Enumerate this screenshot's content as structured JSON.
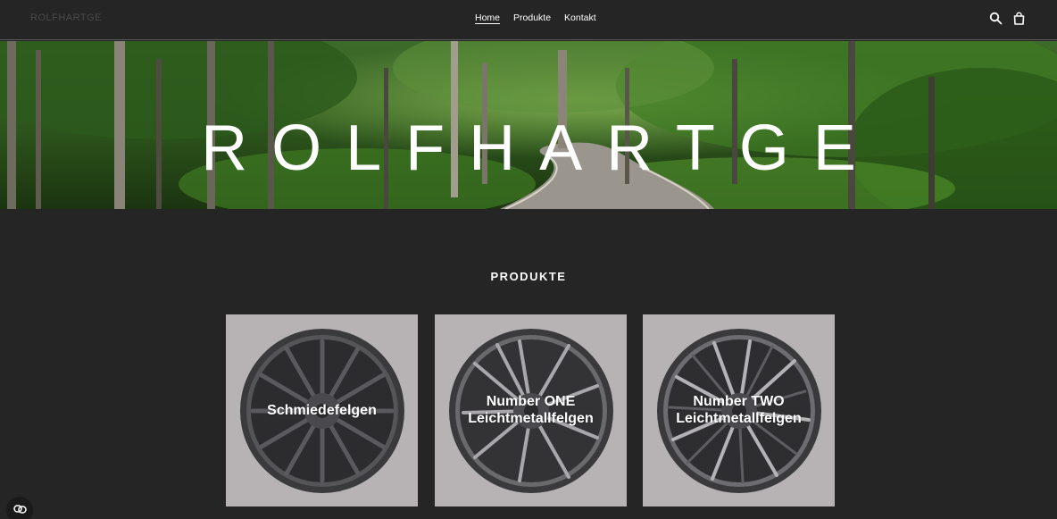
{
  "header": {
    "logo": "ROLFHARTGE",
    "nav": [
      {
        "label": "Home",
        "active": true
      },
      {
        "label": "Produkte",
        "active": false
      },
      {
        "label": "Kontakt",
        "active": false
      }
    ],
    "icons": [
      "search-icon",
      "cart-icon"
    ]
  },
  "hero": {
    "title": "ROLFHARTGE"
  },
  "products": {
    "heading": "PRODUKTE",
    "cards": [
      {
        "line1": "Schmiedefelgen",
        "line2": ""
      },
      {
        "line1": "Number ONE",
        "line2": "Leichtmetallfelgen"
      },
      {
        "line1": "Number TWO",
        "line2": "Leichtmetallfelgen"
      }
    ]
  },
  "colors": {
    "background": "#252525",
    "card_background": "#b7b3b4",
    "text": "#ffffff"
  }
}
